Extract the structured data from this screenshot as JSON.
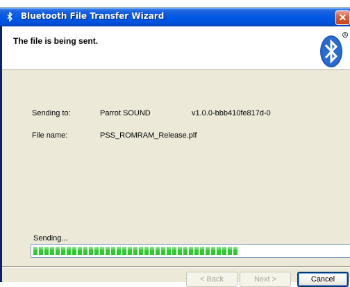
{
  "window": {
    "title": "Bluetooth File Transfer Wizard",
    "close_glyph": "✕"
  },
  "header": {
    "title": "The file is being sent.",
    "logo_icon": "bluetooth-logo-icon"
  },
  "details": {
    "sending_to_label": "Sending to:",
    "sending_to_value": "Parrot SOUND",
    "device_version": "v1.0.0-bbb410fe817d-0",
    "file_name_label": "File name:",
    "file_name_value": "PSS_ROMRAM_Release.plf"
  },
  "progress": {
    "status_label": "Sending...",
    "percent": 0.65,
    "color": "#2fcf2f"
  },
  "buttons": {
    "back": "< Back",
    "next": "Next >",
    "cancel": "Cancel"
  },
  "colors": {
    "titlebar": "#0058e6",
    "client": "#ece9d8",
    "close": "#c9421c"
  }
}
